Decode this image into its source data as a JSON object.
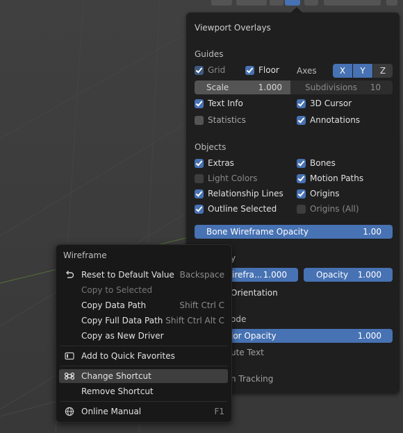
{
  "overlays": {
    "title": "Viewport Overlays",
    "guides": {
      "heading": "Guides",
      "grid": {
        "label": "Grid",
        "checked": true
      },
      "floor": {
        "label": "Floor",
        "checked": true
      },
      "axes_label": "Axes",
      "axes": [
        "X",
        "Y",
        "Z"
      ],
      "scale": {
        "label": "Scale",
        "value": "1.000"
      },
      "subdivisions": {
        "label": "Subdivisions",
        "value": "10"
      },
      "text_info": {
        "label": "Text Info",
        "checked": true
      },
      "cursor_3d": {
        "label": "3D Cursor",
        "checked": true
      },
      "statistics": {
        "label": "Statistics",
        "checked": false
      },
      "annotations": {
        "label": "Annotations",
        "checked": true
      }
    },
    "objects": {
      "heading": "Objects",
      "extras": {
        "label": "Extras",
        "checked": true
      },
      "bones": {
        "label": "Bones",
        "checked": true
      },
      "light_colors": {
        "label": "Light Colors",
        "checked": false
      },
      "motion_paths": {
        "label": "Motion Paths",
        "checked": true
      },
      "relationship_lines": {
        "label": "Relationship Lines",
        "checked": true
      },
      "origins": {
        "label": "Origins",
        "checked": true
      },
      "outline_selected": {
        "label": "Outline Selected",
        "checked": true
      },
      "origins_all": {
        "label": "Origins (All)",
        "checked": false
      },
      "bone_wire": {
        "label": "Bone Wireframe Opacity",
        "value": "1.00"
      }
    },
    "partial": {
      "geometry_heading_tail": "y",
      "wireframe": {
        "label": "irefra...",
        "value": "1.000"
      },
      "opacity": {
        "label": "Opacity",
        "value": "1.000"
      },
      "orientation": "Orientation",
      "mode_heading_tail": "ode",
      "color_opacity": {
        "label": "lor Opacity",
        "value": "1.000"
      },
      "text_tail": "ute Text",
      "tracking_tail": "n Tracking"
    }
  },
  "menu": {
    "title": "Wireframe",
    "items": [
      {
        "label": "Reset to Default Value",
        "shortcut": "Backspace",
        "icon": "reset-icon"
      },
      {
        "label": "Copy to Selected",
        "shortcut": "",
        "disabled": true
      },
      {
        "label": "Copy Data Path",
        "shortcut": "Shift Ctrl C"
      },
      {
        "label": "Copy Full Data Path",
        "shortcut": "Shift Ctrl Alt C"
      },
      {
        "label": "Copy as New Driver",
        "shortcut": ""
      },
      {
        "label": "Add to Quick Favorites",
        "shortcut": "",
        "icon": "favorites-icon"
      },
      {
        "label": "Change Shortcut",
        "shortcut": "",
        "icon": "shortcut-icon",
        "highlighted": true
      },
      {
        "label": "Remove Shortcut",
        "shortcut": ""
      },
      {
        "label": "Online Manual",
        "shortcut": "F1",
        "icon": "globe-icon"
      }
    ]
  },
  "colors": {
    "accent": "#4772b3",
    "panel_bg": "#1f1f1f",
    "menu_bg": "#181818"
  }
}
